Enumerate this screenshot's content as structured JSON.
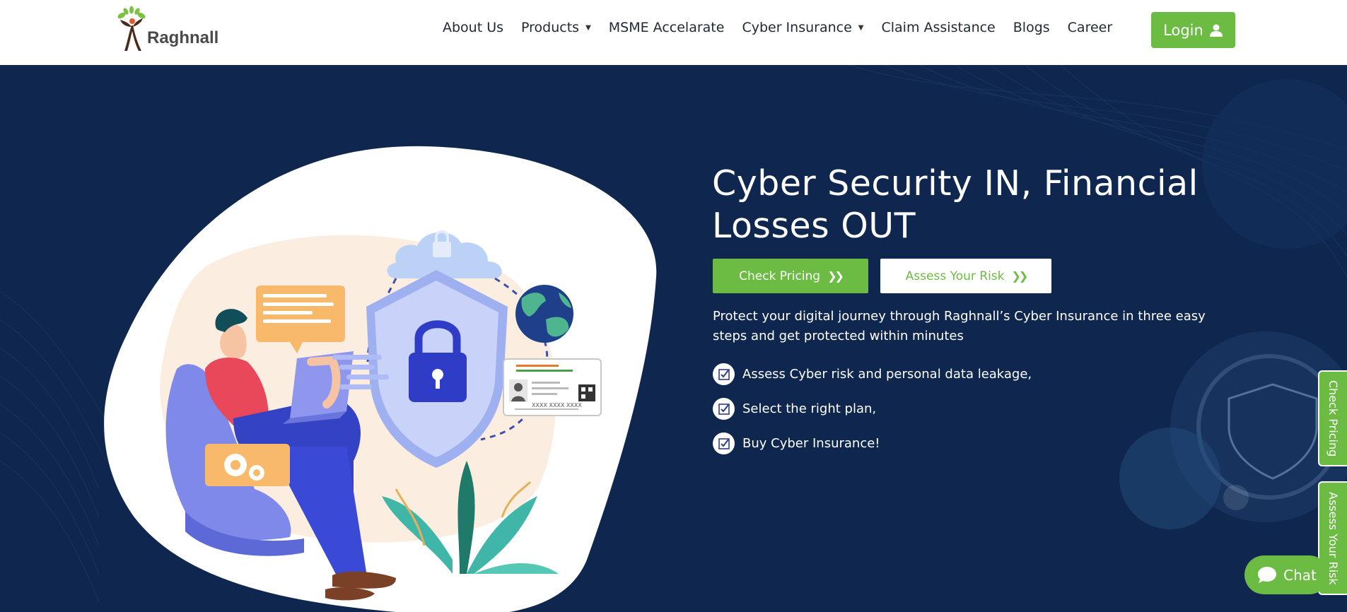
{
  "brand": {
    "name": "Raghnall"
  },
  "nav": {
    "items": [
      {
        "label": "About Us",
        "dropdown": false
      },
      {
        "label": "Products",
        "dropdown": true
      },
      {
        "label": "MSME Accelarate",
        "dropdown": false
      },
      {
        "label": "Cyber Insurance",
        "dropdown": true
      },
      {
        "label": "Claim Assistance",
        "dropdown": false
      },
      {
        "label": "Blogs",
        "dropdown": false
      },
      {
        "label": "Career",
        "dropdown": false
      }
    ],
    "caret": "▼",
    "login_label": "Login"
  },
  "hero": {
    "title_line1": "Cyber Security IN, Financial",
    "title_line2": "Losses OUT",
    "check_pricing_label": "Check Pricing",
    "assess_risk_label": "Assess Your Risk",
    "description": "Protect your digital journey through Raghnall’s Cyber Insurance in three easy steps and get protected within minutes",
    "steps": [
      "Assess Cyber risk and personal data leakage,",
      "Select the right plan,",
      "Buy Cyber Insurance!"
    ],
    "id_card_number": "XXXX XXXX XXXX"
  },
  "side_tabs": {
    "pricing": "Check Pricing",
    "risk": "Assess Your Risk"
  },
  "chat": {
    "label": "Chat"
  },
  "colors": {
    "navy": "#0f274e",
    "green": "#6cbb43",
    "white": "#ffffff"
  }
}
